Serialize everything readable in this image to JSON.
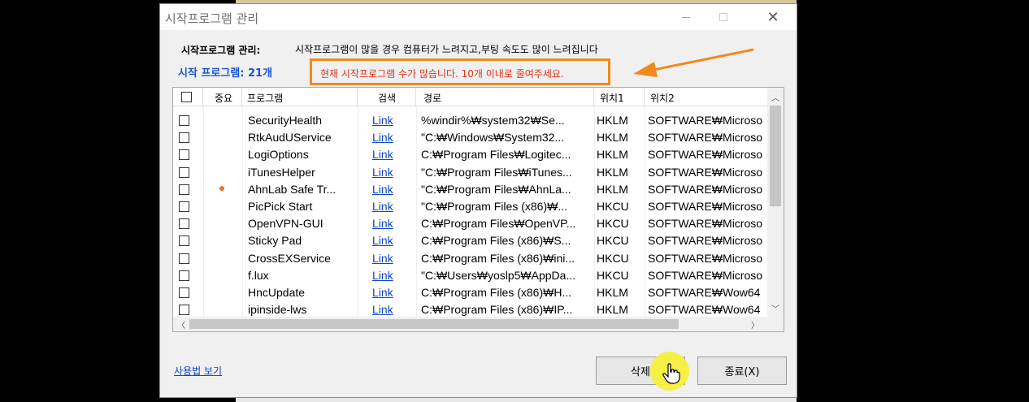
{
  "window": {
    "title": "시작프로그램 관리"
  },
  "header": {
    "label": "시작프로그램 관리:",
    "description": "시작프로그램이 많을 경우 컴퓨터가 느려지고,부팅 속도도 많이 느려집니다",
    "count": "시작 프로그램: 21개",
    "warning": "현재 시작프로그램 수가 많습니다. 10개 이내로 줄여주세요."
  },
  "table": {
    "columns": [
      "",
      "중요",
      "프로그램",
      "검색",
      "경로",
      "위치1",
      "위치2"
    ],
    "rows": [
      {
        "important": false,
        "program": "SecurityHealth",
        "search": "Link",
        "path": "%windir%₩system32₩Se...",
        "loc1": "HKLM",
        "loc2": "SOFTWARE₩Microso"
      },
      {
        "important": false,
        "program": "RtkAudUService",
        "search": "Link",
        "path": "\"C:₩Windows₩System32...",
        "loc1": "HKLM",
        "loc2": "SOFTWARE₩Microso"
      },
      {
        "important": false,
        "program": "LogiOptions",
        "search": "Link",
        "path": "C:₩Program Files₩Logitec...",
        "loc1": "HKLM",
        "loc2": "SOFTWARE₩Microso"
      },
      {
        "important": false,
        "program": "iTunesHelper",
        "search": "Link",
        "path": "\"C:₩Program Files₩iTunes...",
        "loc1": "HKLM",
        "loc2": "SOFTWARE₩Microso"
      },
      {
        "important": true,
        "program": "AhnLab Safe Tr...",
        "search": "Link",
        "path": "\"C:₩Program Files₩AhnLa...",
        "loc1": "HKLM",
        "loc2": "SOFTWARE₩Microso"
      },
      {
        "important": false,
        "program": "PicPick Start",
        "search": "Link",
        "path": "\"C:₩Program Files (x86)₩...",
        "loc1": "HKCU",
        "loc2": "SOFTWARE₩Microso"
      },
      {
        "important": false,
        "program": "OpenVPN-GUI",
        "search": "Link",
        "path": "C:₩Program Files₩OpenVP...",
        "loc1": "HKCU",
        "loc2": "SOFTWARE₩Microso"
      },
      {
        "important": false,
        "program": "Sticky Pad",
        "search": "Link",
        "path": "C:₩Program Files (x86)₩S...",
        "loc1": "HKCU",
        "loc2": "SOFTWARE₩Microso"
      },
      {
        "important": false,
        "program": "CrossEXService",
        "search": "Link",
        "path": "C:₩Program Files (x86)₩ini...",
        "loc1": "HKCU",
        "loc2": "SOFTWARE₩Microso"
      },
      {
        "important": false,
        "program": "f.lux",
        "search": "Link",
        "path": "\"C:₩Users₩yoslp5₩AppDa...",
        "loc1": "HKCU",
        "loc2": "SOFTWARE₩Microso"
      },
      {
        "important": false,
        "program": "HncUpdate",
        "search": "Link",
        "path": "C:₩Program Files (x86)₩H...",
        "loc1": "HKLM",
        "loc2": "SOFTWARE₩Wow64"
      },
      {
        "important": false,
        "program": "ipinside-lws",
        "search": "Link",
        "path": "C:₩Program Files (x86)₩IP...",
        "loc1": "HKLM",
        "loc2": "SOFTWARE₩Wow64"
      }
    ]
  },
  "footer": {
    "howto": "사용법 보기",
    "delete": "삭제",
    "exit": "종료(X)"
  },
  "colors": {
    "accent_blue": "#1a55d6",
    "warning_border": "#f08a1c",
    "warning_text": "#e0341a",
    "cursor_highlight": "#f7ef3c"
  },
  "icons": [
    "minimize-icon",
    "maximize-icon",
    "close-icon",
    "checkbox-icon",
    "important-dot-icon",
    "scroll-up-icon",
    "scroll-down-icon",
    "scroll-left-icon",
    "scroll-right-icon",
    "hand-cursor-icon",
    "arrow-annotation-icon"
  ]
}
